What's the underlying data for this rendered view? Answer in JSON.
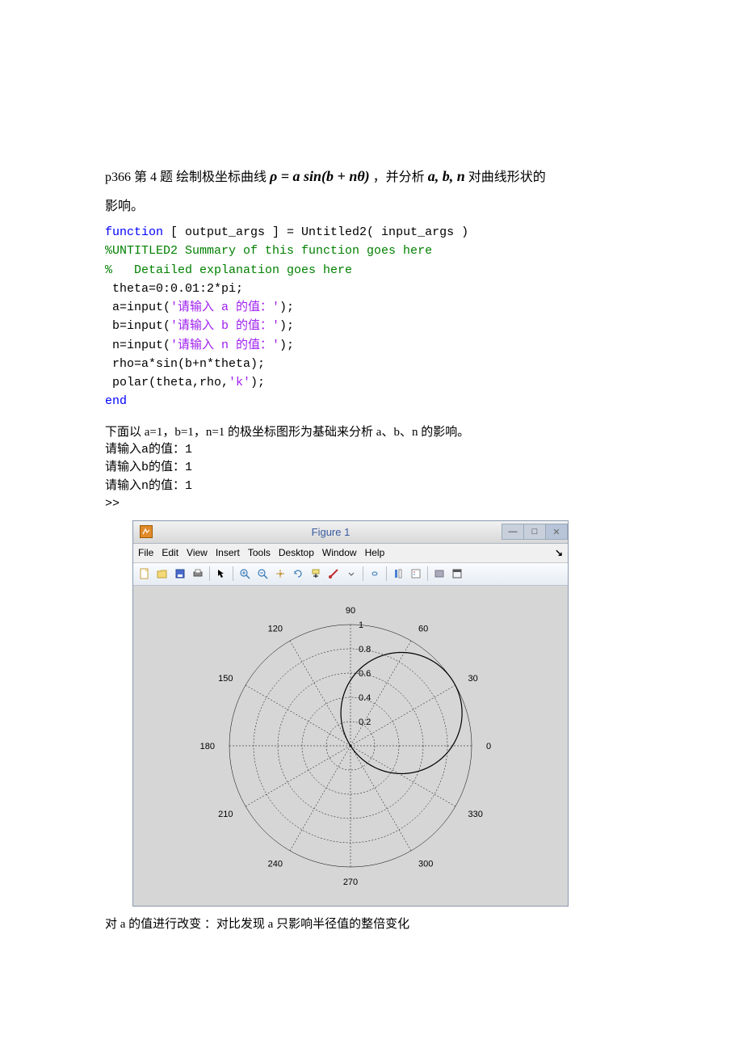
{
  "problem": {
    "prefix": "p366 第 4 题 绘制极坐标曲线",
    "formula": "ρ = a sin(b + nθ)",
    "mid": "，并分析",
    "vars": "a, b, n",
    "suffix1": "对曲线形状的",
    "suffix2": "影响。"
  },
  "code": {
    "l1a": "function",
    "l1b": " [ output_args ] = Untitled2( input_args )",
    "l2": "%UNTITLED2 Summary of this function goes here",
    "l3": "%   Detailed explanation goes here",
    "l4": " theta=0:0.01:2*pi;",
    "l5a": " a=input(",
    "l5b": "'请输入 a 的值：'",
    "l5c": ");",
    "l6a": " b=input(",
    "l6b": "'请输入 b 的值：'",
    "l6c": ");",
    "l7a": " n=input(",
    "l7b": "'请输入 n 的值：'",
    "l7c": ");",
    "l8": " rho=a*sin(b+n*theta);",
    "l9a": " polar(theta,rho,",
    "l9b": "'k'",
    "l9c": ");",
    "l10": "end"
  },
  "analysis_intro": "下面以 a=1，b=1，n=1 的极坐标图形为基础来分析 a、b、n 的影响。",
  "cmd": {
    "l1": "请输入a的值：1",
    "l2": "请输入b的值：1",
    "l3": "请输入n的值：1",
    "l4": ">>"
  },
  "figure": {
    "title": "Figure 1",
    "menu": [
      "File",
      "Edit",
      "View",
      "Insert",
      "Tools",
      "Desktop",
      "Window",
      "Help"
    ],
    "toolbar_icons": [
      "new",
      "open",
      "save",
      "print",
      "arrow",
      "zoom-in",
      "zoom-out",
      "pan",
      "rotate",
      "data-cursor",
      "brush",
      "link",
      "colorbar",
      "legend",
      "hide",
      "dock"
    ]
  },
  "chart_data": {
    "type": "polar",
    "title": "",
    "angle_labels_deg": [
      0,
      30,
      60,
      90,
      120,
      150,
      180,
      210,
      240,
      270,
      300,
      330
    ],
    "radial_ticks": [
      0.2,
      0.4,
      0.6,
      0.8,
      1
    ],
    "rlim": [
      0,
      1
    ],
    "series": [
      {
        "name": "rho = 1*sin(1 + 1*theta)",
        "color": "black",
        "formula": "a*sin(b+n*theta)",
        "a": 1,
        "b": 1,
        "n": 1,
        "theta_range_rad": [
          0,
          6.2832
        ],
        "theta_step": 0.01
      }
    ]
  },
  "conclusion": "对 a 的值进行改变 ：对比发现 a 只影响半径值的整倍变化"
}
